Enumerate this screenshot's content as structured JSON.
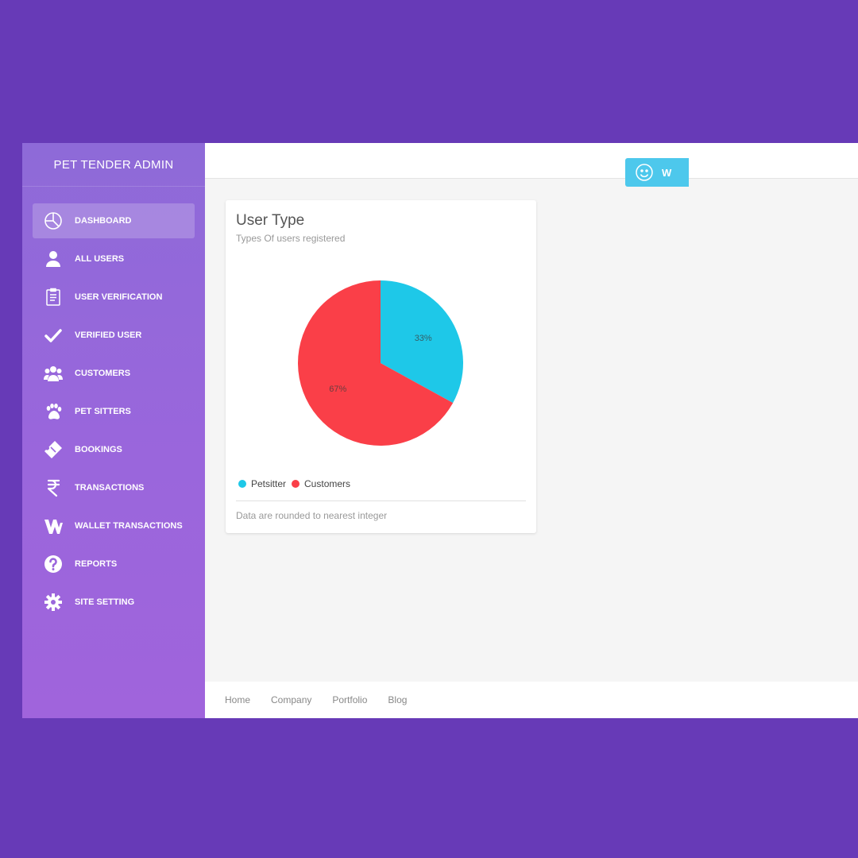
{
  "sidebar": {
    "brand": "PET TENDER ADMIN",
    "items": [
      {
        "label": "DASHBOARD",
        "icon": "pie-chart-icon"
      },
      {
        "label": "ALL USERS",
        "icon": "user-icon"
      },
      {
        "label": "USER VERIFICATION",
        "icon": "clipboard-icon"
      },
      {
        "label": "VERIFIED USER",
        "icon": "check-icon"
      },
      {
        "label": "CUSTOMERS",
        "icon": "users-group-icon"
      },
      {
        "label": "PET SITTERS",
        "icon": "paw-icon"
      },
      {
        "label": "BOOKINGS",
        "icon": "ticket-icon"
      },
      {
        "label": "TRANSACTIONS",
        "icon": "rupee-icon"
      },
      {
        "label": "WALLET TRANSACTIONS",
        "icon": "wallet-icon"
      },
      {
        "label": "REPORTS",
        "icon": "question-icon"
      },
      {
        "label": "SITE SETTING",
        "icon": "gear-icon"
      }
    ],
    "active_index": 0
  },
  "topbar": {
    "welcome_label": "W",
    "welcome_icon": "smiley-icon"
  },
  "card": {
    "title": "User Type",
    "subtitle": "Types Of users registered",
    "footer_note": "Data are rounded to nearest integer"
  },
  "chart_data": {
    "type": "pie",
    "title": "User Type",
    "subtitle": "Types Of users registered",
    "slices": [
      {
        "name": "Petsitter",
        "value": 33,
        "label": "33%",
        "color": "#1ec8e8"
      },
      {
        "name": "Customers",
        "value": 67,
        "label": "67%",
        "color": "#fa3f48"
      }
    ],
    "legend": "bottom-left"
  },
  "footer": {
    "links": [
      "Home",
      "Company",
      "Portfolio",
      "Blog"
    ]
  },
  "colors": {
    "page_background": "#673ab7",
    "sidebar_top": "#8e6ad8",
    "sidebar_bottom": "#a064dc",
    "accent_cyan": "#4dc8ec"
  }
}
